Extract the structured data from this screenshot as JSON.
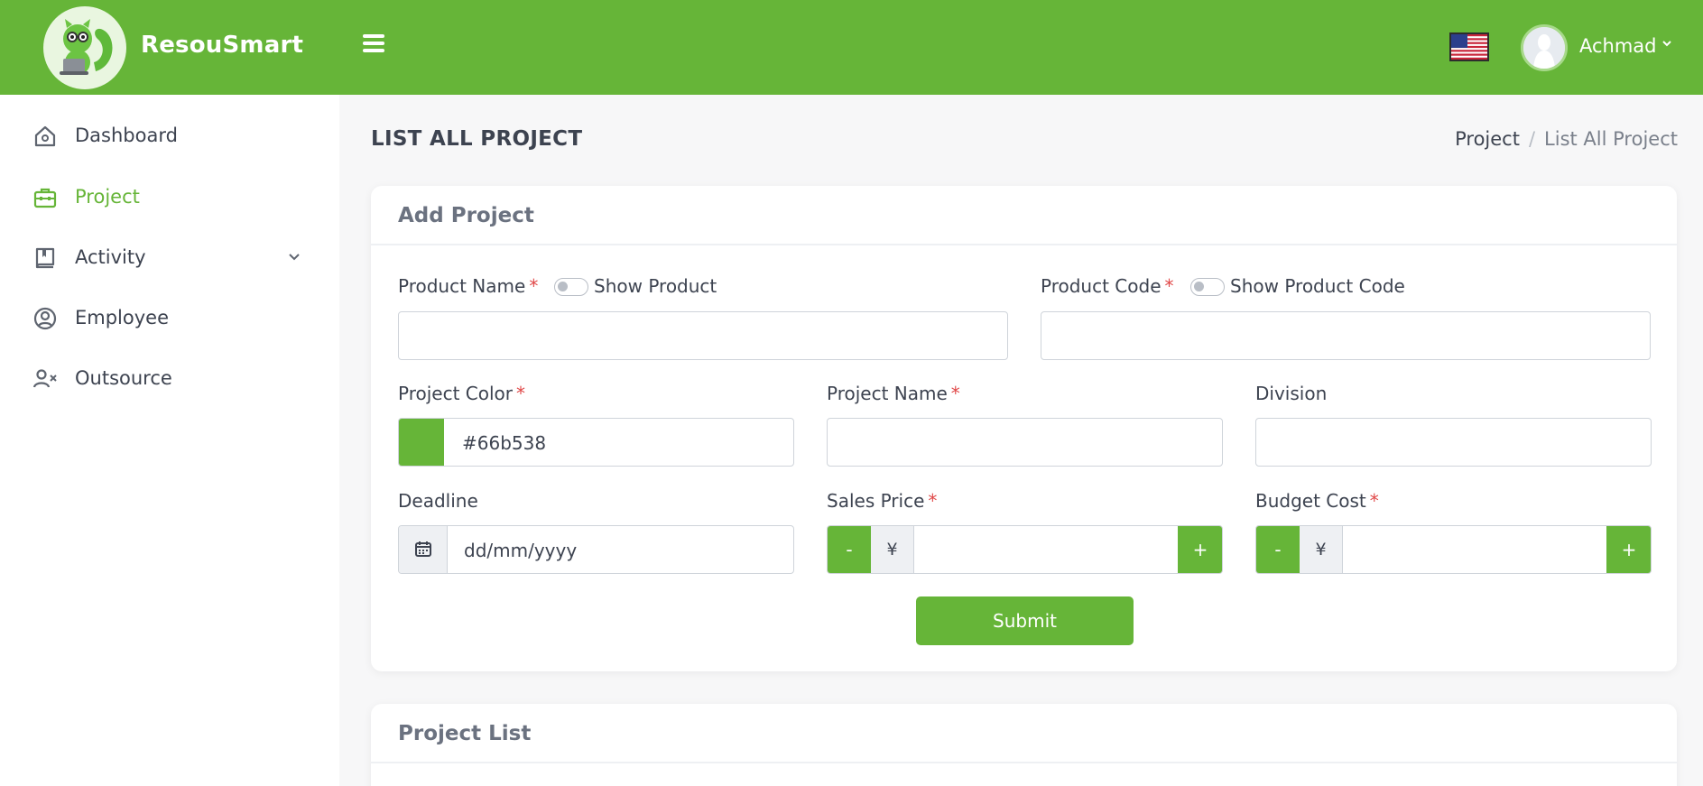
{
  "header": {
    "brand": "ResouSmart",
    "username": "Achmad",
    "brand_color": "#66b538",
    "icons": [
      "squirrel-logo",
      "menu-icon",
      "us-flag-icon",
      "avatar",
      "chevron-down-icon"
    ]
  },
  "sidebar": {
    "items": [
      {
        "label": "Dashboard",
        "icon": "home-icon",
        "active": false
      },
      {
        "label": "Project",
        "icon": "briefcase-icon",
        "active": true
      },
      {
        "label": "Activity",
        "icon": "book-icon",
        "active": false,
        "has_submenu": true
      },
      {
        "label": "Employee",
        "icon": "user-circle-icon",
        "active": false
      },
      {
        "label": "Outsource",
        "icon": "user-x-icon",
        "active": false
      }
    ]
  },
  "page": {
    "title": "LIST ALL PROJECT",
    "breadcrumb": {
      "parent": "Project",
      "separator": "/",
      "current": "List All Project"
    }
  },
  "add_project": {
    "title": "Add Project",
    "product_name": {
      "label": "Product Name",
      "required": "*",
      "toggle_label": "Show Product",
      "value": ""
    },
    "product_code": {
      "label": "Product Code",
      "required": "*",
      "toggle_label": "Show Product Code",
      "value": ""
    },
    "project_color": {
      "label": "Project Color",
      "required": "*",
      "value": "#66b538"
    },
    "project_name": {
      "label": "Project Name",
      "required": "*",
      "value": ""
    },
    "division": {
      "label": "Division",
      "value": ""
    },
    "deadline": {
      "label": "Deadline",
      "placeholder": "dd/mm/yyyy"
    },
    "sales_price": {
      "label": "Sales Price",
      "required": "*",
      "currency": "¥",
      "minus": "-",
      "plus": "+",
      "value": ""
    },
    "budget_cost": {
      "label": "Budget Cost",
      "required": "*",
      "currency": "¥",
      "minus": "-",
      "plus": "+",
      "value": ""
    },
    "submit_label": "Submit"
  },
  "project_list": {
    "title": "Project List"
  }
}
